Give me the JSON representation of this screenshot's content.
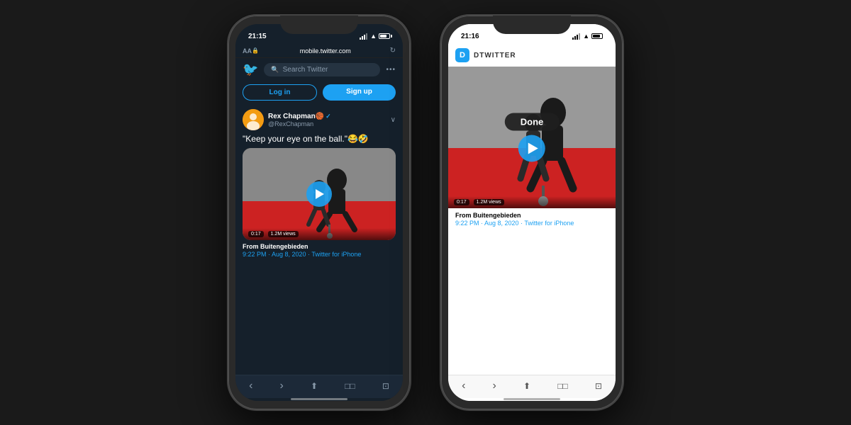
{
  "background_color": "#1a1a1a",
  "left_phone": {
    "status": {
      "time": "21:15",
      "battery_level": 75
    },
    "browser": {
      "aa_label": "AA",
      "url": "mobile.twitter.com",
      "reload_icon": "↻"
    },
    "nav": {
      "search_placeholder": "Search Twitter",
      "more_icon": "•••"
    },
    "auth": {
      "login_label": "Log in",
      "signup_label": "Sign up"
    },
    "tweet": {
      "user_name": "Rex Chapman🏀",
      "user_handle": "@RexChapman",
      "text": "\"Keep your eye on the ball.\"😂🤣",
      "video_duration": "0:17",
      "video_views": "1.2M views",
      "source_prefix": "From ",
      "source_name": "Buitengebieden",
      "timestamp": "9:22 PM · Aug 8, 2020 · ",
      "platform": "Twitter for iPhone"
    },
    "browser_nav": {
      "back": "‹",
      "forward": "›",
      "share": "⬆",
      "bookmarks": "□□",
      "tabs": "⊡"
    }
  },
  "right_phone": {
    "status": {
      "time": "21:16",
      "battery_level": 80
    },
    "app_header": {
      "icon": "D",
      "name": "DTWITTER"
    },
    "done_label": "Done",
    "video": {
      "duration": "0:17",
      "views": "1.2M views"
    },
    "tweet": {
      "source_prefix": "From ",
      "source_name": "Buitengebieden",
      "timestamp": "9:22 PM · Aug 8, 2020 · ",
      "platform": "Twitter for iPhone"
    },
    "browser_nav": {
      "back": "‹",
      "forward": "›",
      "share": "⬆",
      "bookmarks": "□□",
      "tabs": "⊡"
    }
  }
}
